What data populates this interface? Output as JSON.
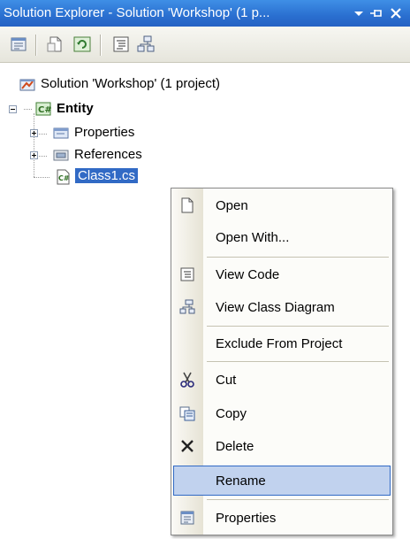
{
  "window": {
    "title": "Solution Explorer - Solution 'Workshop' (1 p..."
  },
  "toolbar": {
    "buttons": [
      "properties-icon",
      "show-all-files-icon",
      "refresh-icon",
      "view-code-icon",
      "view-class-diagram-icon"
    ]
  },
  "tree": {
    "solution": "Solution 'Workshop' (1 project)",
    "project": "Entity",
    "properties": "Properties",
    "references": "References",
    "file": "Class1.cs"
  },
  "context_menu": {
    "items": [
      {
        "label": "Open"
      },
      {
        "label": "Open With..."
      },
      {
        "label": "View Code"
      },
      {
        "label": "View Class Diagram"
      },
      {
        "label": "Exclude From Project"
      },
      {
        "label": "Cut"
      },
      {
        "label": "Copy"
      },
      {
        "label": "Delete"
      },
      {
        "label": "Rename"
      },
      {
        "label": "Properties"
      }
    ],
    "highlighted": "Rename"
  },
  "colors": {
    "titlebar": "#2a6fd0",
    "selection": "#316ac5",
    "menu_highlight": "#c1d2ee"
  }
}
